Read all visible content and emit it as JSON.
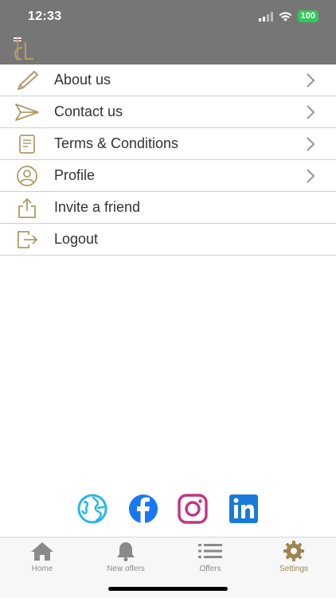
{
  "status_bar": {
    "time": "12:33",
    "battery": "100"
  },
  "menu": {
    "items": [
      {
        "label": "About us",
        "icon": "pencil-icon",
        "chevron": true
      },
      {
        "label": "Contact us",
        "icon": "send-icon",
        "chevron": true
      },
      {
        "label": "Terms & Conditions",
        "icon": "document-icon",
        "chevron": true
      },
      {
        "label": "Profile",
        "icon": "user-circle-icon",
        "chevron": true
      },
      {
        "label": "Invite a friend",
        "icon": "share-icon",
        "chevron": false
      },
      {
        "label": "Logout",
        "icon": "logout-icon",
        "chevron": false
      }
    ]
  },
  "social": [
    {
      "icon": "globe-icon",
      "color": "#29b6e8"
    },
    {
      "icon": "facebook-icon",
      "color": "#1877f2"
    },
    {
      "icon": "instagram-icon",
      "color": "#c13584"
    },
    {
      "icon": "linkedin-icon",
      "color": "#1a7ad9"
    }
  ],
  "tabbar": {
    "tabs": [
      {
        "label": "Home",
        "icon": "home-icon",
        "active": false
      },
      {
        "label": "New offers",
        "icon": "bell-icon",
        "active": false
      },
      {
        "label": "Offers",
        "icon": "list-icon",
        "active": false
      },
      {
        "label": "Settings",
        "icon": "gear-icon",
        "active": true
      }
    ]
  },
  "colors": {
    "accent": "#a08552",
    "header": "#767676",
    "icon_gold": "#b39a6a"
  }
}
